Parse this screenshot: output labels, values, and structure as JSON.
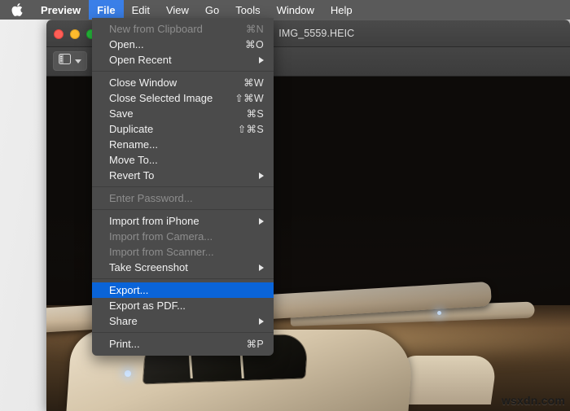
{
  "menubar": {
    "apple_icon": "apple-logo-icon",
    "items": [
      {
        "label": "Preview",
        "bold": true,
        "active": false
      },
      {
        "label": "File",
        "bold": true,
        "active": true
      },
      {
        "label": "Edit",
        "bold": false,
        "active": false
      },
      {
        "label": "View",
        "bold": false,
        "active": false
      },
      {
        "label": "Go",
        "bold": false,
        "active": false
      },
      {
        "label": "Tools",
        "bold": false,
        "active": false
      },
      {
        "label": "Window",
        "bold": false,
        "active": false
      },
      {
        "label": "Help",
        "bold": false,
        "active": false
      }
    ]
  },
  "file_menu": {
    "open": true,
    "groups": [
      {
        "items": [
          {
            "label": "New from Clipboard",
            "shortcut": "⌘N",
            "disabled": true,
            "submenu": false,
            "selected": false
          },
          {
            "label": "Open...",
            "shortcut": "⌘O",
            "disabled": false,
            "submenu": false,
            "selected": false
          },
          {
            "label": "Open Recent",
            "shortcut": "",
            "disabled": false,
            "submenu": true,
            "selected": false
          }
        ]
      },
      {
        "items": [
          {
            "label": "Close Window",
            "shortcut": "⌘W",
            "disabled": false,
            "submenu": false,
            "selected": false
          },
          {
            "label": "Close Selected Image",
            "shortcut": "⇧⌘W",
            "disabled": false,
            "submenu": false,
            "selected": false
          },
          {
            "label": "Save",
            "shortcut": "⌘S",
            "disabled": false,
            "submenu": false,
            "selected": false
          },
          {
            "label": "Duplicate",
            "shortcut": "⇧⌘S",
            "disabled": false,
            "submenu": false,
            "selected": false
          },
          {
            "label": "Rename...",
            "shortcut": "",
            "disabled": false,
            "submenu": false,
            "selected": false
          },
          {
            "label": "Move To...",
            "shortcut": "",
            "disabled": false,
            "submenu": false,
            "selected": false
          },
          {
            "label": "Revert To",
            "shortcut": "",
            "disabled": false,
            "submenu": true,
            "selected": false
          }
        ]
      },
      {
        "items": [
          {
            "label": "Enter Password...",
            "shortcut": "",
            "disabled": true,
            "submenu": false,
            "selected": false
          }
        ]
      },
      {
        "items": [
          {
            "label": "Import from iPhone",
            "shortcut": "",
            "disabled": false,
            "submenu": true,
            "selected": false
          },
          {
            "label": "Import from Camera...",
            "shortcut": "",
            "disabled": true,
            "submenu": false,
            "selected": false
          },
          {
            "label": "Import from Scanner...",
            "shortcut": "",
            "disabled": true,
            "submenu": false,
            "selected": false
          },
          {
            "label": "Take Screenshot",
            "shortcut": "",
            "disabled": false,
            "submenu": true,
            "selected": false
          }
        ]
      },
      {
        "items": [
          {
            "label": "Export...",
            "shortcut": "",
            "disabled": false,
            "submenu": false,
            "selected": true
          },
          {
            "label": "Export as PDF...",
            "shortcut": "",
            "disabled": false,
            "submenu": false,
            "selected": false
          },
          {
            "label": "Share",
            "shortcut": "",
            "disabled": false,
            "submenu": true,
            "selected": false
          }
        ]
      },
      {
        "items": [
          {
            "label": "Print...",
            "shortcut": "⌘P",
            "disabled": false,
            "submenu": false,
            "selected": false
          }
        ]
      }
    ]
  },
  "window": {
    "title": "IMG_5559.HEIC",
    "title_icon": "heic-document-icon",
    "traffic_lights": [
      {
        "name": "close-button",
        "color": "#ff5f57"
      },
      {
        "name": "minimize-button",
        "color": "#febc2e"
      },
      {
        "name": "zoom-button",
        "color": "#28c840"
      }
    ],
    "toolbar": {
      "sidebar_button_icon": "sidebar-panel-icon",
      "sidebar_dropdown_icon": "chevron-down-icon"
    }
  },
  "content": {
    "photo_description": "Night photograph of a small single-engine airplane on tarmac",
    "watermark": "wsxdn.com"
  },
  "colors": {
    "menubar_bg": "#5a5a5a",
    "menu_bg": "#4b4b4b",
    "menu_highlight": "#0a64d8",
    "menubar_highlight": "#3a7fe8",
    "titlebar_bg": "#434343"
  }
}
